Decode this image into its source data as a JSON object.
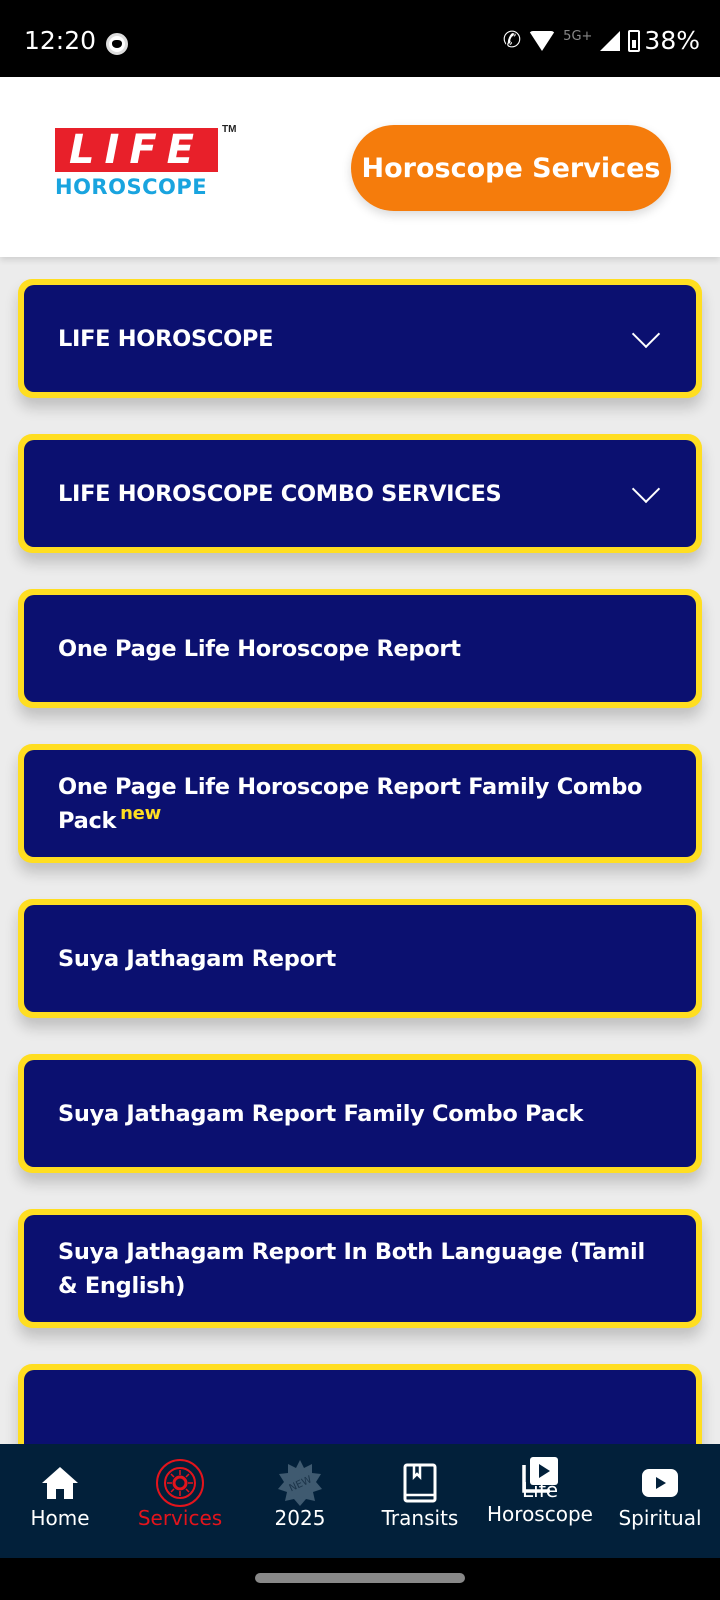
{
  "status_bar": {
    "time": "12:20",
    "network": "5G+",
    "battery": "38%"
  },
  "header": {
    "logo_top": "LIFE",
    "logo_bottom": "HOROSCOPE",
    "logo_tm": "TM",
    "services_button": "Horoscope Services"
  },
  "services": [
    {
      "label": "LIFE HOROSCOPE",
      "expandable": true
    },
    {
      "label": "LIFE HOROSCOPE COMBO SERVICES",
      "expandable": true
    },
    {
      "label": "One Page Life Horoscope Report"
    },
    {
      "label": "One Page Life Horoscope Report Family Combo Pack",
      "badge": "new"
    },
    {
      "label": "Suya Jathagam Report"
    },
    {
      "label": "Suya Jathagam Report Family Combo Pack"
    },
    {
      "label": "Suya Jathagam Report In Both Language (Tamil & English)"
    },
    {
      "label": ""
    }
  ],
  "bottom_nav": {
    "items": [
      {
        "label": "Home",
        "icon": "home-icon"
      },
      {
        "label": "Services",
        "icon": "zodiac-wheel-icon",
        "active": true
      },
      {
        "label": "2025",
        "icon": "new-badge-icon",
        "badge": "NEW"
      },
      {
        "label": "Transits",
        "icon": "book-icon"
      },
      {
        "label": "Life Horoscope",
        "icon": "video-library-icon"
      },
      {
        "label": "Spiritual",
        "icon": "youtube-icon"
      }
    ]
  },
  "colors": {
    "accent_orange": "#f57c0c",
    "card_navy": "#0b1070",
    "card_border_yellow": "#ffde21",
    "nav_bg": "#02203a",
    "nav_active": "#e3141c"
  }
}
